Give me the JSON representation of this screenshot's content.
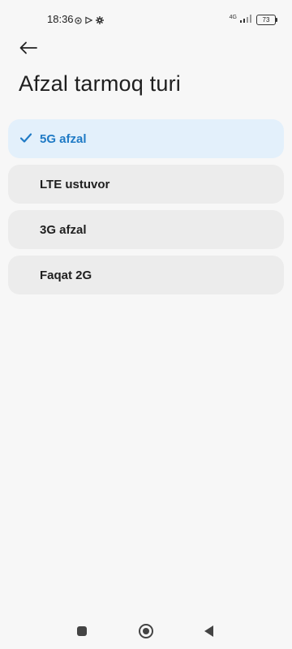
{
  "status_bar": {
    "time": "18:36",
    "network_type": "4G",
    "battery_level": "73",
    "icons": [
      "vpn-icon",
      "play-icon",
      "gear-icon",
      "signal-icon",
      "battery-icon"
    ]
  },
  "header": {
    "back_icon": "arrow-left-icon",
    "title": "Afzal tarmoq turi"
  },
  "options": [
    {
      "label": "5G afzal",
      "selected": true
    },
    {
      "label": "LTE ustuvor",
      "selected": false
    },
    {
      "label": "3G afzal",
      "selected": false
    },
    {
      "label": "Faqat 2G",
      "selected": false
    }
  ],
  "colors": {
    "accent": "#1f7ac5",
    "selected_bg": "#e3f0fb",
    "item_bg": "#ececec",
    "page_bg": "#f7f7f7"
  },
  "nav_bar": {
    "icons": [
      "recent-apps-icon",
      "home-icon",
      "back-triangle-icon"
    ]
  }
}
